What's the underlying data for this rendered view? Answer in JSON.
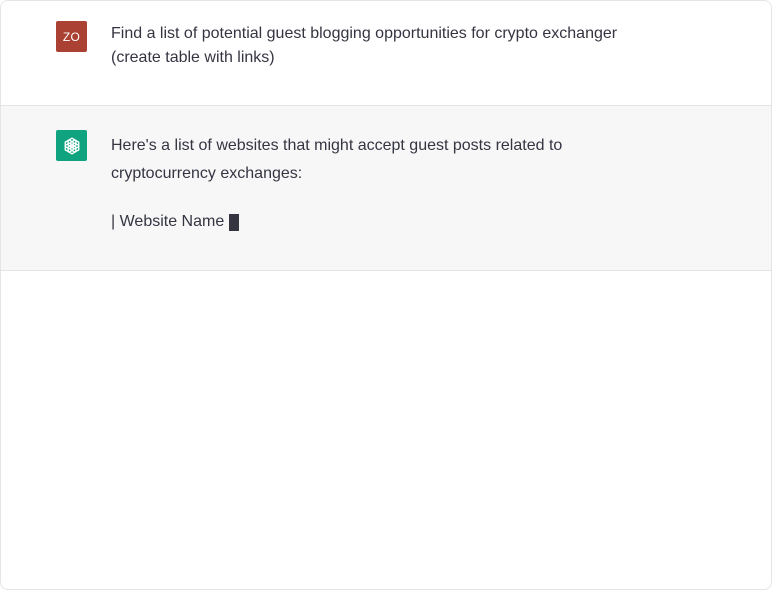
{
  "conversation": {
    "user": {
      "avatar_initials": "ZO",
      "avatar_color": "#ab4133",
      "message": "Find a list of potential guest blogging opportunities for crypto exchanger\n(create table with links)"
    },
    "assistant": {
      "avatar_icon": "openai-logo-icon",
      "avatar_color": "#10a37f",
      "intro": "Here's a list of websites that might accept guest posts related to cryptocurrency exchanges:",
      "partial_line": "| Website Name",
      "streaming": true
    }
  }
}
